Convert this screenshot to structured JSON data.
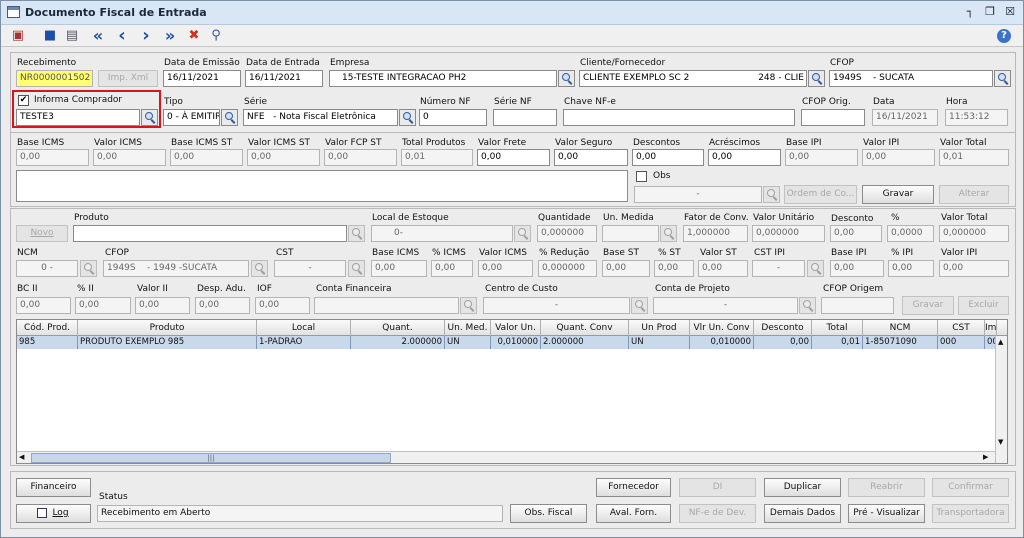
{
  "window": {
    "title": "Documento Fiscal de Entrada",
    "minimize": "┐",
    "restore": "❐",
    "close": "☒"
  },
  "toolbar": {
    "new": "▣",
    "save": "■",
    "doc": "▤",
    "first": "«",
    "prev": "‹",
    "next": "›",
    "last": "»",
    "delete": "✖",
    "search": "⚲",
    "help": "?"
  },
  "header": {
    "recebimento_label": "Recebimento",
    "recebimento_value": "NR0000001502",
    "imp_xml": "Imp. Xml",
    "data_emissao_label": "Data de Emissão",
    "data_emissao_value": "16/11/2021",
    "data_entrada_label": "Data de Entrada",
    "data_entrada_value": "16/11/2021",
    "empresa_label": "Empresa",
    "empresa_value": "15-TESTE INTEGRACAO PH2",
    "cliente_label": "Cliente/Fornecedor",
    "cliente_value": "CLIENTE EXEMPLO SC 2",
    "cliente_code": "248 - CLIE",
    "cfop_label": "CFOP",
    "cfop_value": "1949S    - SUCATA",
    "informa_comprador_label": "Informa Comprador",
    "informa_comprador_check": "✔",
    "comprador_value": "TESTE3",
    "tipo_label": "Tipo",
    "tipo_value": "0 - À EMITIR",
    "serie_label": "Série",
    "serie_value": "NFE   - Nota Fiscal Eletrônica",
    "numero_nf_label": "Número NF",
    "numero_nf_value": "0",
    "serie_nf_label": "Série NF",
    "serie_nf_value": "",
    "chave_label": "Chave NF-e",
    "chave_value": "",
    "cfop_orig_label": "CFOP Orig.",
    "cfop_orig_value": "",
    "data_label": "Data",
    "data_value": "16/11/2021",
    "hora_label": "Hora",
    "hora_value": "11:53:12"
  },
  "totals": [
    {
      "label": "Base ICMS",
      "value": "0,00"
    },
    {
      "label": "Valor ICMS",
      "value": "0,00"
    },
    {
      "label": "Base ICMS ST",
      "value": "0,00"
    },
    {
      "label": "Valor ICMS ST",
      "value": "0,00"
    },
    {
      "label": "Valor FCP ST",
      "value": "0,00"
    },
    {
      "label": "Total Produtos",
      "value": "0,01"
    },
    {
      "label": "Valor Frete",
      "value": "0,00"
    },
    {
      "label": "Valor Seguro",
      "value": "0,00"
    },
    {
      "label": "Descontos",
      "value": "0,00"
    },
    {
      "label": "Acréscimos",
      "value": "0,00"
    },
    {
      "label": "Base IPI",
      "value": "0,00"
    },
    {
      "label": "Valor IPI",
      "value": "0,00"
    },
    {
      "label": "Valor Total",
      "value": "0,01"
    }
  ],
  "obs": {
    "label": "Obs",
    "combo_value": "-",
    "ordem": "Ordem de Co...",
    "gravar": "Gravar",
    "alterar": "Alterar"
  },
  "item": {
    "produto_label": "Produto",
    "novo": "Novo",
    "produto_value": "",
    "local_label": "Local de Estoque",
    "local_value": "0-",
    "quantidade_label": "Quantidade",
    "quantidade_value": "0,000000",
    "un_medida_label": "Un. Medida",
    "un_medida_value": "",
    "fator_label": "Fator de Conv.",
    "fator_value": "1,000000",
    "valor_unit_label": "Valor Unitário",
    "valor_unit_value": "0,000000",
    "desconto_label": "Desconto",
    "desconto_value": "0,00",
    "pct_label": "%",
    "pct_value": "0,0000",
    "valor_total_label": "Valor Total",
    "valor_total_value": "0,000000",
    "ncm_label": "NCM",
    "ncm_value": "0 -",
    "cfop_label": "CFOP",
    "cfop_value": "1949S    - 1949 -SUCATA",
    "cst_label": "CST",
    "cst_value": "-",
    "base_icms_label": "Base ICMS",
    "base_icms_value": "0,00",
    "pct_icms_label": "% ICMS",
    "pct_icms_value": "0,00",
    "valor_icms_label": "Valor ICMS",
    "valor_icms_value": "0,00",
    "pct_reducao_label": "% Redução",
    "pct_reducao_value": "0,000000",
    "base_st_label": "Base ST",
    "base_st_value": "0,00",
    "pct_st_label": "% ST",
    "pct_st_value": "0,00",
    "valor_st_label": "Valor ST",
    "valor_st_value": "0,00",
    "cst_ipi_label": "CST IPI",
    "cst_ipi_value": "-",
    "base_ipi_label": "Base IPI",
    "base_ipi_value": "0,00",
    "pct_ipi_label": "% IPI",
    "pct_ipi_value": "0,00",
    "valor_ipi_label": "Valor IPI",
    "valor_ipi_value": "0,00",
    "bc_ii_label": "BC II",
    "bc_ii_value": "0,00",
    "pct_ii_label": "% II",
    "pct_ii_value": "0,00",
    "valor_ii_label": "Valor II",
    "valor_ii_value": "0,00",
    "desp_adu_label": "Desp. Adu.",
    "desp_adu_value": "0,00",
    "iof_label": "IOF",
    "iof_value": "0,00",
    "conta_fin_label": "Conta Financeira",
    "conta_fin_value": "",
    "centro_label": "Centro de Custo",
    "centro_value": "-",
    "conta_proj_label": "Conta de Projeto",
    "conta_proj_value": "-",
    "cfop_origem_label": "CFOP Origem",
    "cfop_origem_value": "",
    "gravar": "Gravar",
    "excluir": "Excluir"
  },
  "grid": {
    "headers": [
      "Cód. Prod.",
      "Produto",
      "Local",
      "Quant.",
      "Un. Med.",
      "Valor Un.",
      "Quant. Conv",
      "Un Prod",
      "Vlr Un. Conv",
      "Desconto",
      "Total",
      "NCM",
      "CST",
      "Im"
    ],
    "rows": [
      [
        "985",
        "PRODUTO  EXEMPLO 985",
        "1-PADRAO",
        "2.000000",
        "UN",
        "0,010000",
        "2.000000",
        "UN",
        "0,010000",
        "0,00",
        "0,01",
        "1-85071090",
        "000",
        "000"
      ]
    ],
    "hscroll_grip": "|||"
  },
  "footer": {
    "financeiro": "Financeiro",
    "log": "Log",
    "status_label": "Status",
    "status_value": "Recebimento em Aberto",
    "fornecedor": "Fornecedor",
    "di": "DI",
    "duplicar": "Duplicar",
    "reabrir": "Reabrir",
    "confirmar": "Confirmar",
    "obs_fiscal": "Obs. Fiscal",
    "aval_forn": "Aval. Forn.",
    "nfe_dev": "NF-e de Dev.",
    "demais_dados": "Demais Dados",
    "pre_visualizar": "Pré - Visualizar",
    "transportadora": "Transportadora"
  }
}
